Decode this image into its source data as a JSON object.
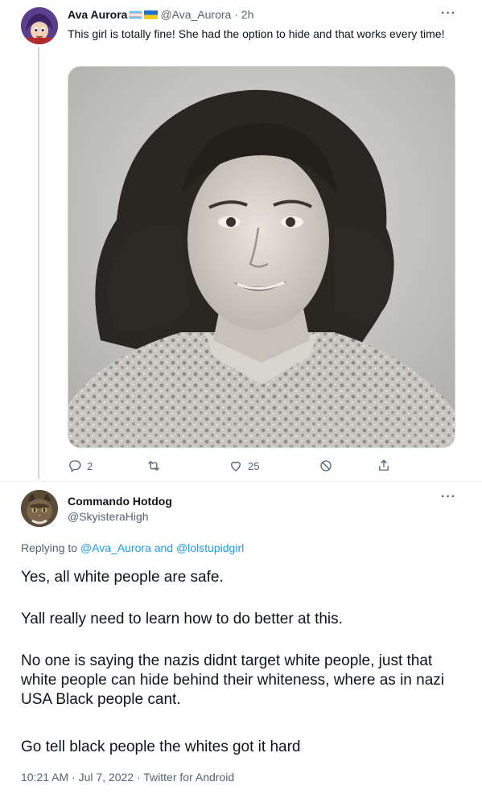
{
  "tweet1": {
    "author_name": "Ava Aurora",
    "handle": "@Ava_Aurora",
    "separator": "·",
    "time": "2h",
    "text": "This girl is totally fine! She had the option to hide and that works every time!",
    "more_label": "···",
    "actions": {
      "reply_count": "2",
      "retweet_count": "",
      "like_count": "25"
    },
    "flags": [
      "transgender-flag",
      "ukraine-flag"
    ],
    "icons": [
      "reply-icon",
      "retweet-icon",
      "like-icon",
      "block-icon",
      "share-icon"
    ]
  },
  "tweet2": {
    "author_name": "Commando Hotdog",
    "handle": "@SkyisteraHigh",
    "more_label": "···",
    "replying_prefix": "Replying to",
    "replying_mention_1": "@Ava_Aurora",
    "replying_and": "and",
    "replying_mention_2": "@lolstupidgirl",
    "paragraphs": [
      "Yes, all white people are safe.",
      "Yall really need to learn how to do better at this.",
      "No one is saying the nazis didnt target white people, just that white people can hide behind their whiteness, where as in nazi USA Black people cant.",
      "Go tell black people the whites got it hard"
    ],
    "meta": "10:21 AM · Jul 7, 2022 · Twitter for Android"
  },
  "colors": {
    "link": "#1d9bf0",
    "secondary_text": "#536471",
    "primary_text": "#0f1419",
    "thread_line": "#cfd9de"
  }
}
